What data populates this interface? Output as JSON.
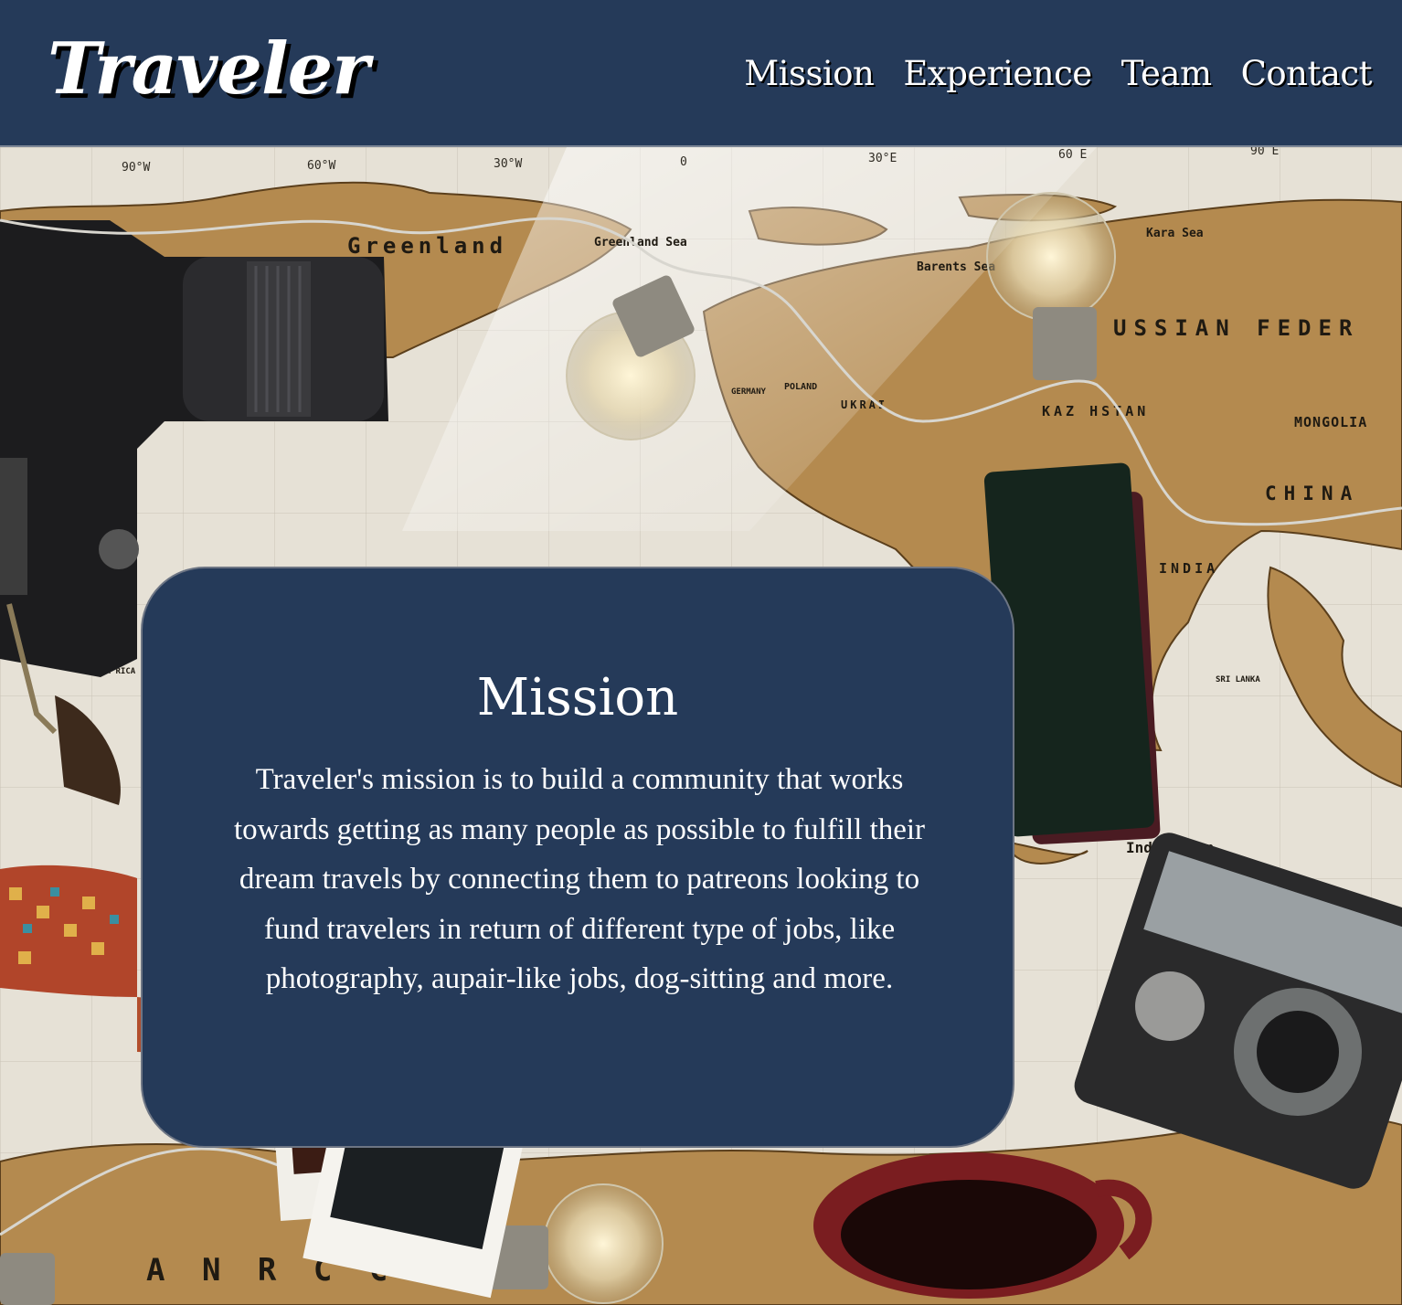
{
  "header": {
    "logo": "Traveler",
    "nav": [
      {
        "label": "Mission"
      },
      {
        "label": "Experience"
      },
      {
        "label": "Team"
      },
      {
        "label": "Contact"
      }
    ]
  },
  "hero": {
    "background_image": "world map with camera, light bulbs, passport and polaroid photos",
    "map_labels": {
      "greenland": "Greenland",
      "greenland_sea": "Greenland Sea",
      "kara_sea": "Kara Sea",
      "barents_sea": "Barents Sea",
      "russian_federation": "USSIAN FEDER",
      "kazakhstan": "KAZ HSTAN",
      "mongolia": "MONGOLIA",
      "china": "CHINA",
      "india": "INDIA",
      "indian_ocean": "Indi  Ocean",
      "sri_lanka": "SRI LANKA",
      "costa_rica": "COSTA RICA",
      "ukraine": "UKRAI",
      "poland": "POLAND",
      "germany": "GERMANY",
      "antarctica": "A N        R    C     C    A",
      "lon_90w": "90°W",
      "lon_60w": "60°W",
      "lon_30w": "30°W",
      "lon_0": "0",
      "lon_30e": "30°E",
      "lon_60e": "60 E",
      "lon_90e": "90 E"
    }
  },
  "mission": {
    "title": "Mission",
    "body": "Traveler's mission is to build a community that works towards getting as many people as possible to fulfill their dream travels by connecting them to patreons looking to fund travelers in return of different type of jobs, like photography, aupair-like jobs, dog-sitting and more."
  },
  "colors": {
    "navy": "#253a59",
    "white": "#ffffff"
  }
}
